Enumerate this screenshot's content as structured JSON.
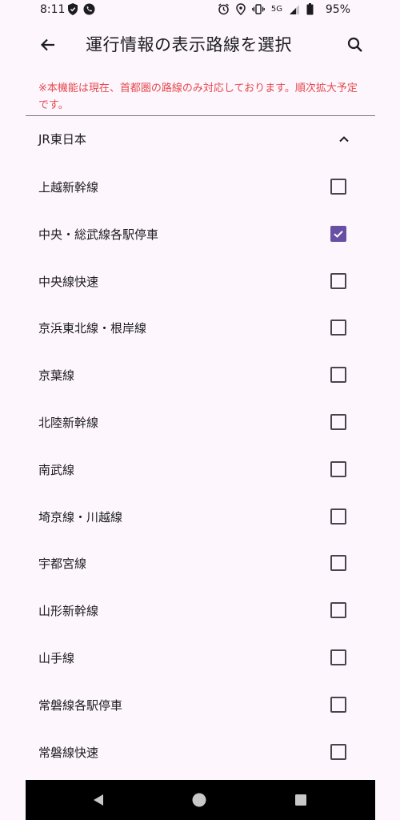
{
  "status_bar": {
    "time": "8:11",
    "network": "5G",
    "battery": "95%"
  },
  "app_bar": {
    "title": "運行情報の表示路線を選択"
  },
  "notice": "※本機能は現在、首都圏の路線のみ対応しております。順次拡大予定です。",
  "group": {
    "name": "JR東日本",
    "expanded": true
  },
  "lines": [
    {
      "name": "上越新幹線",
      "checked": false
    },
    {
      "name": "中央・総武線各駅停車",
      "checked": true
    },
    {
      "name": "中央線快速",
      "checked": false
    },
    {
      "name": "京浜東北線・根岸線",
      "checked": false
    },
    {
      "name": "京葉線",
      "checked": false
    },
    {
      "name": "北陸新幹線",
      "checked": false
    },
    {
      "name": "南武線",
      "checked": false
    },
    {
      "name": "埼京線・川越線",
      "checked": false
    },
    {
      "name": "宇都宮線",
      "checked": false
    },
    {
      "name": "山形新幹線",
      "checked": false
    },
    {
      "name": "山手線",
      "checked": false
    },
    {
      "name": "常磐線各駅停車",
      "checked": false
    },
    {
      "name": "常磐線快速",
      "checked": false
    }
  ],
  "colors": {
    "accent": "#6750a4",
    "notice": "#e5484d",
    "background": "#fdf7fd"
  }
}
